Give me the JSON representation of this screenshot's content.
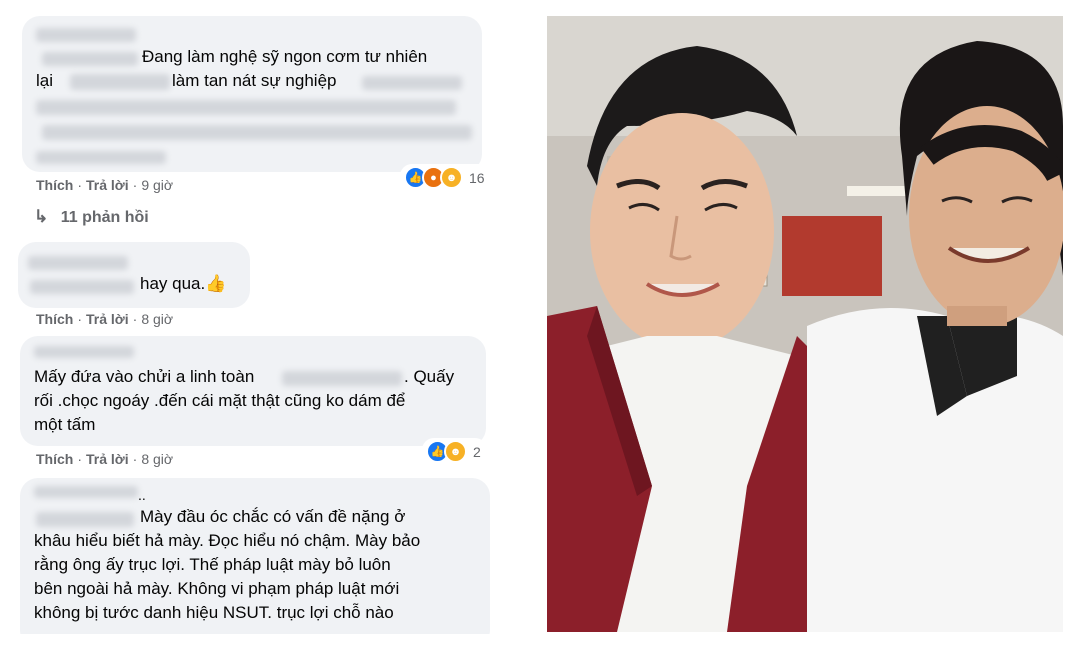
{
  "comments": [
    {
      "lines": [
        "Đang làm nghệ sỹ ngon cơm tư nhiên",
        "lại",
        "làm tan nát sự nghiệp"
      ],
      "actions": {
        "like": "Thích",
        "reply": "Trả lời",
        "time": "9 giờ"
      },
      "reaction_count": "16"
    },
    {
      "lines": [
        "hay qua."
      ],
      "actions": {
        "like": "Thích",
        "reply": "Trả lời",
        "time": "8 giờ"
      }
    },
    {
      "lines": [
        "Mấy đứa vào chửi a linh toàn",
        ". Quấy",
        "rối .chọc ngoáy .đến cái mặt thật cũng ko dám để",
        "một tấm"
      ],
      "actions": {
        "like": "Thích",
        "reply": "Trả lời",
        "time": "8 giờ"
      },
      "reaction_count": "2"
    },
    {
      "lines": [
        "..",
        "Mày đầu óc chắc có vấn đề nặng ở",
        "khâu hiểu biết hả mày. Đọc hiểu nó chậm. Mày bảo",
        "rằng ông ấy trục lợi. Thế pháp luật mày bỏ luôn",
        "bên ngoài hả mày. Không vi phạm pháp luật mới",
        "không bị tước danh hiệu NSUT. trục lợi chỗ nào"
      ]
    }
  ],
  "replies_link": "11 phản hồi",
  "icons": {
    "reply_arrow": "reply-arrow-icon",
    "thumbs_up": "thumbs-up-emoji-icon"
  },
  "colors": {
    "bubble": "#f0f2f5",
    "meta": "#65676b",
    "text": "#050505",
    "like": "#1877f2",
    "angry": "#e9710f",
    "haha": "#f7b125"
  }
}
